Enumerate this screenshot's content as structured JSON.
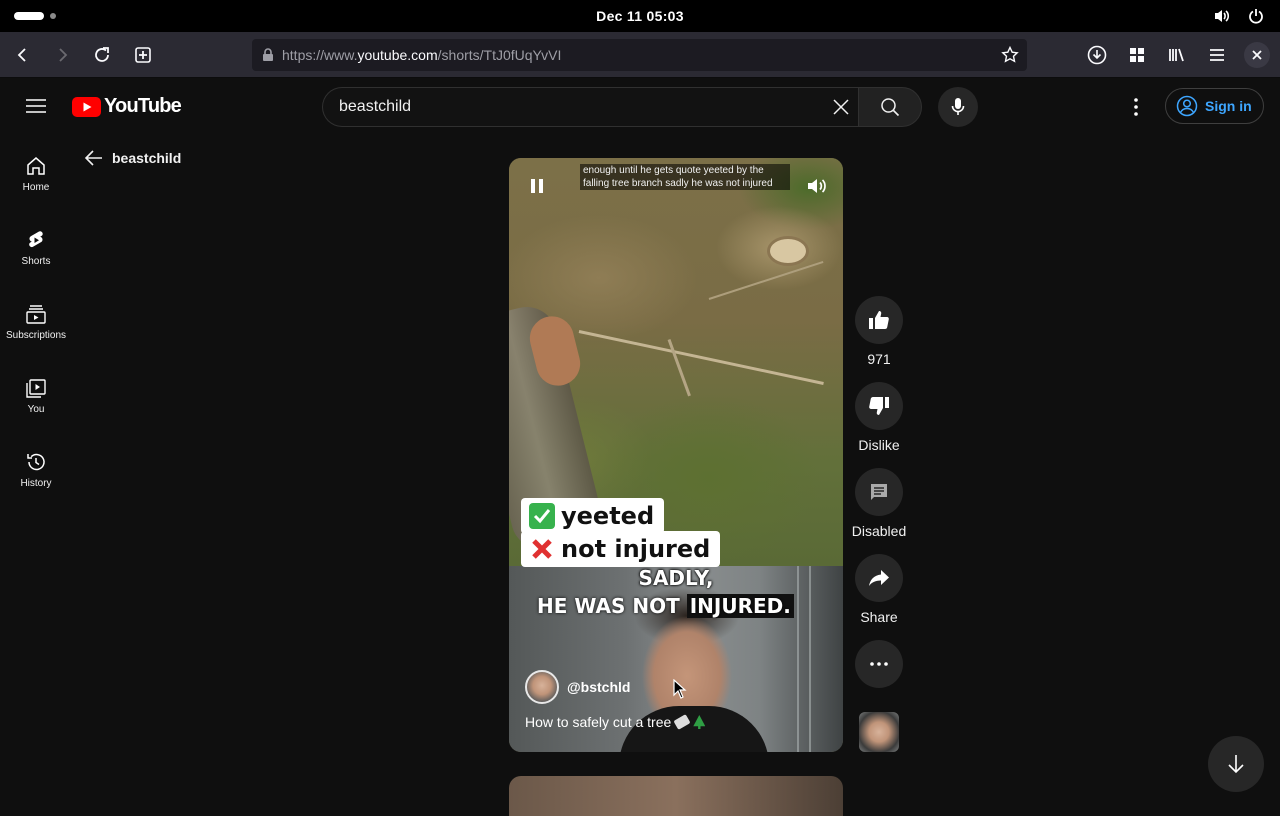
{
  "os": {
    "clock": "Dec 11  05:03"
  },
  "browser": {
    "url_prefix": "https://www.",
    "url_host": "youtube.com",
    "url_path": "/shorts/TtJ0fUqYvVI"
  },
  "youtube": {
    "logo_text": "YouTube",
    "search_value": "beastchild",
    "sign_in_label": "Sign in",
    "guide": [
      {
        "label": "Home",
        "icon": "home-icon"
      },
      {
        "label": "Shorts",
        "icon": "shorts-icon"
      },
      {
        "label": "Subscriptions",
        "icon": "subscriptions-icon"
      },
      {
        "label": "You",
        "icon": "you-icon"
      },
      {
        "label": "History",
        "icon": "history-icon"
      }
    ],
    "back_label": "beastchild"
  },
  "short": {
    "caption_top": "enough until he gets quote yeeted by the falling tree branch sadly he was not injured",
    "sticker_yes": "yeeted",
    "sticker_no": "not injured",
    "overlay_line1": "SADLY,",
    "overlay_line2a": "HE WAS NOT ",
    "overlay_line2b": "INJURED.",
    "channel_handle": "@bstchld",
    "title": "How to safely cut a tree"
  },
  "actions": {
    "like_count": "971",
    "dislike_label": "Dislike",
    "comments_label": "Disabled",
    "share_label": "Share"
  },
  "colors": {
    "background": "#0f0f0f",
    "accent_blue": "#3ea6ff",
    "youtube_red": "#ff0000",
    "button_bg": "#272727"
  }
}
